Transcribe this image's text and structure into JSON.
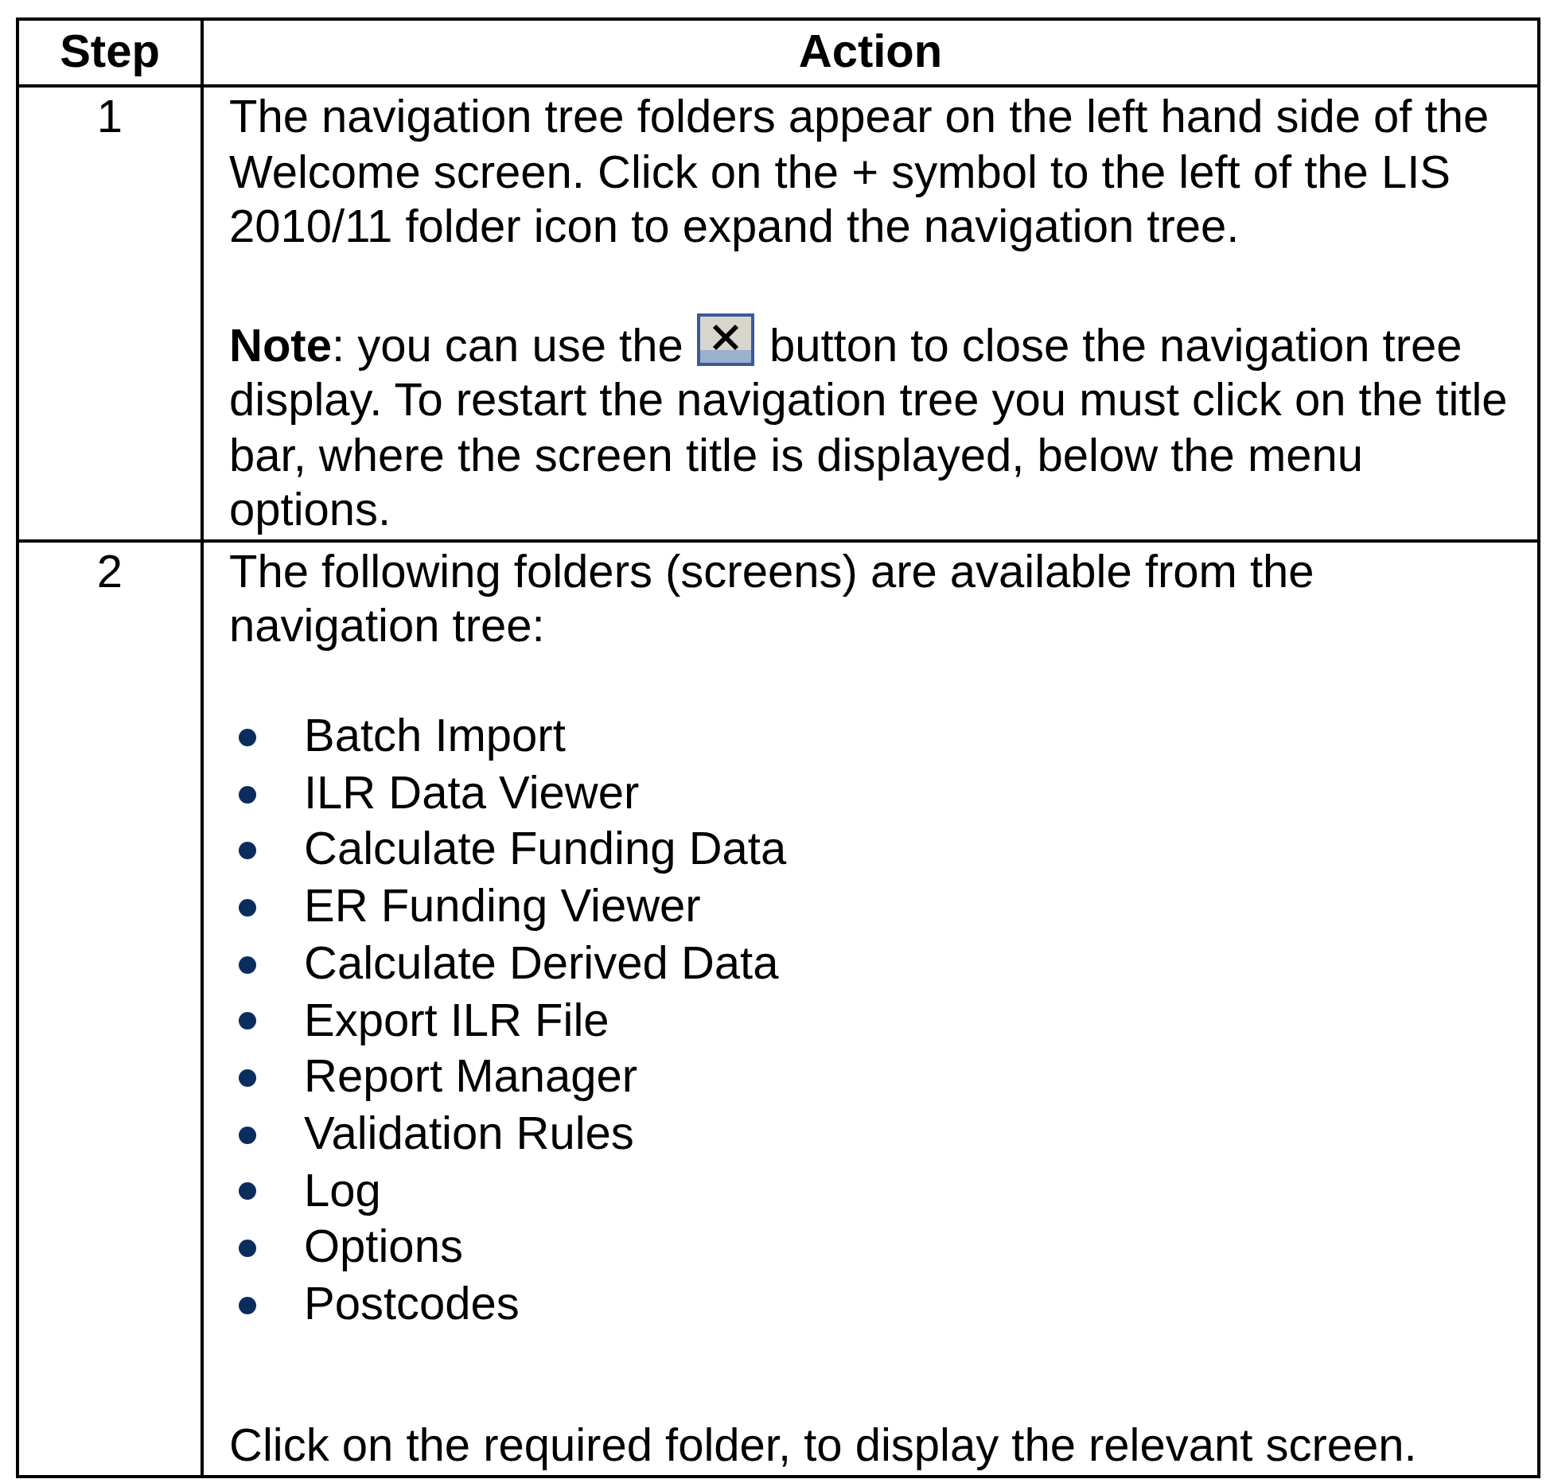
{
  "table": {
    "columns": [
      "Step",
      "Action"
    ],
    "rows": [
      {
        "step": "1",
        "content": [
          {
            "kind": "paragraph",
            "text": "The navigation tree folders appear on the left hand side of the Welcome screen. Click on the + symbol to the left of the LIS 2010/11 folder icon to expand the navigation tree."
          },
          {
            "kind": "icon_paragraph",
            "before": "**Note**: you can use the",
            "after": "button to close the navigation tree display. To restart the navigation tree you must click on the title bar, where the screen title is displayed, below the menu options."
          }
        ]
      },
      {
        "step": "2",
        "content": [
          {
            "kind": "paragraph",
            "text": "The following folders (screens) are available from the navigation tree:"
          },
          {
            "kind": "bullets",
            "items": [
              "Batch Import",
              "ILR Data Viewer",
              "Calculate Funding Data",
              "ER Funding Viewer",
              "Calculate Derived Data",
              "Export ILR File",
              "Report Manager",
              "Validation Rules",
              "Log",
              "Options",
              "Postcodes"
            ]
          },
          {
            "kind": "paragraph",
            "text": "Click on the required folder, to display the relevant screen."
          }
        ]
      }
    ]
  }
}
